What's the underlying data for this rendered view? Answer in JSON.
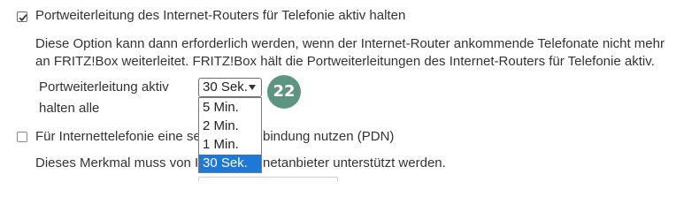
{
  "option_keep_ports": {
    "checked": true,
    "label": "Portweiterleitung des Internet-Routers für Telefonie aktiv halten",
    "description_line1": "Diese Option kann dann erforderlich werden, wenn der Internet-Router ankommende Telefonate nicht mehr",
    "description_line2": "an FRITZ!Box weiterleitet. FRITZ!Box hält die Portweiterleitungen des Internet-Routers für Telefonie aktiv.",
    "interval_label_line1": "Portweiterleitung aktiv",
    "interval_label_line2": "halten alle",
    "select": {
      "value": "30 Sek.",
      "options": [
        "5 Min.",
        "2 Min.",
        "1 Min.",
        "30 Sek."
      ],
      "selected_option": "30 Sek."
    },
    "callout_badge": "22"
  },
  "option_pdn": {
    "checked": false,
    "label_part1": "Für Internettelefonie eine se",
    "label_part2": "bindung nutzen (PDN)",
    "description_part1": "Dieses Merkmal muss von Ih",
    "description_part2": "netanbieter unterstützt werden."
  }
}
